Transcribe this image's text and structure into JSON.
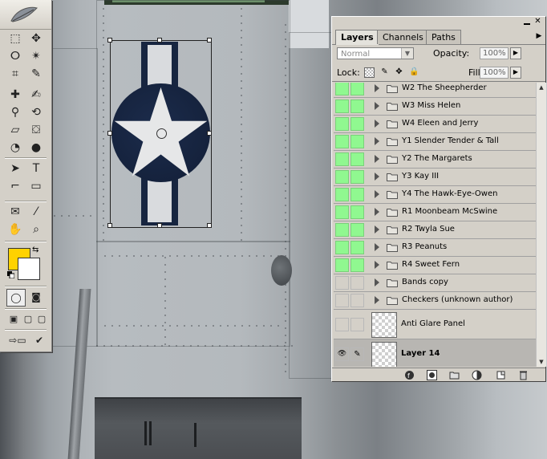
{
  "toolbox": {
    "tools": [
      {
        "name": "rectangular-marquee",
        "glyph": "⬚"
      },
      {
        "name": "move",
        "glyph": "✥"
      },
      {
        "name": "lasso",
        "glyph": "ⵔ"
      },
      {
        "name": "magic-wand",
        "glyph": "✴"
      },
      {
        "name": "crop",
        "glyph": "⌗"
      },
      {
        "name": "slice",
        "glyph": "✎"
      },
      {
        "name": "healing-brush",
        "glyph": "✚"
      },
      {
        "name": "brush",
        "glyph": "✍"
      },
      {
        "name": "clone-stamp",
        "glyph": "⚲"
      },
      {
        "name": "history-brush",
        "glyph": "⟲"
      },
      {
        "name": "eraser",
        "glyph": "▱"
      },
      {
        "name": "paint-bucket",
        "glyph": "⛋"
      },
      {
        "name": "blur",
        "glyph": "◔"
      },
      {
        "name": "burn",
        "glyph": "●"
      },
      {
        "name": "path-selection",
        "glyph": "➤"
      },
      {
        "name": "type",
        "glyph": "T"
      },
      {
        "name": "pen",
        "glyph": "⌐"
      },
      {
        "name": "rectangle",
        "glyph": "▭"
      },
      {
        "name": "notes",
        "glyph": "✉"
      },
      {
        "name": "eyedropper",
        "glyph": "⁄"
      },
      {
        "name": "hand",
        "glyph": "✋"
      },
      {
        "name": "zoom",
        "glyph": "⌕"
      }
    ],
    "foreground_color": "#ffd200",
    "background_color": "#ffffff"
  },
  "layers_panel": {
    "tabs": [
      {
        "label": "Layers",
        "active": true
      },
      {
        "label": "Channels",
        "active": false
      },
      {
        "label": "Paths",
        "active": false
      }
    ],
    "blend_mode": "Normal",
    "opacity_label": "Opacity:",
    "opacity_value": "100%",
    "lock_label": "Lock:",
    "fill_label": "Fill:",
    "fill_value": "100%",
    "layers": [
      {
        "name": "W2 The Sheepherder",
        "type": "group",
        "visible": true
      },
      {
        "name": "W3 Miss Helen",
        "type": "group",
        "visible": true
      },
      {
        "name": "W4 Eleen and Jerry",
        "type": "group",
        "visible": true
      },
      {
        "name": "Y1 Slender Tender & Tall",
        "type": "group",
        "visible": true
      },
      {
        "name": "Y2 The Margarets",
        "type": "group",
        "visible": true
      },
      {
        "name": "Y3 Kay III",
        "type": "group",
        "visible": true
      },
      {
        "name": "Y4 The Hawk-Eye-Owen",
        "type": "group",
        "visible": true
      },
      {
        "name": "R1 Moonbeam McSwine",
        "type": "group",
        "visible": true
      },
      {
        "name": "R2 Twyla Sue",
        "type": "group",
        "visible": true
      },
      {
        "name": "R3 Peanuts",
        "type": "group",
        "visible": true
      },
      {
        "name": "R4 Sweet Fern",
        "type": "group",
        "visible": true
      },
      {
        "name": "Bands copy",
        "type": "group",
        "visible": false
      },
      {
        "name": "Checkers (unknown author)",
        "type": "group",
        "visible": false
      },
      {
        "name": "Anti Glare Panel",
        "type": "layer",
        "visible": false
      },
      {
        "name": "Layer 14",
        "type": "layer",
        "visible": true,
        "selected": true
      }
    ]
  }
}
